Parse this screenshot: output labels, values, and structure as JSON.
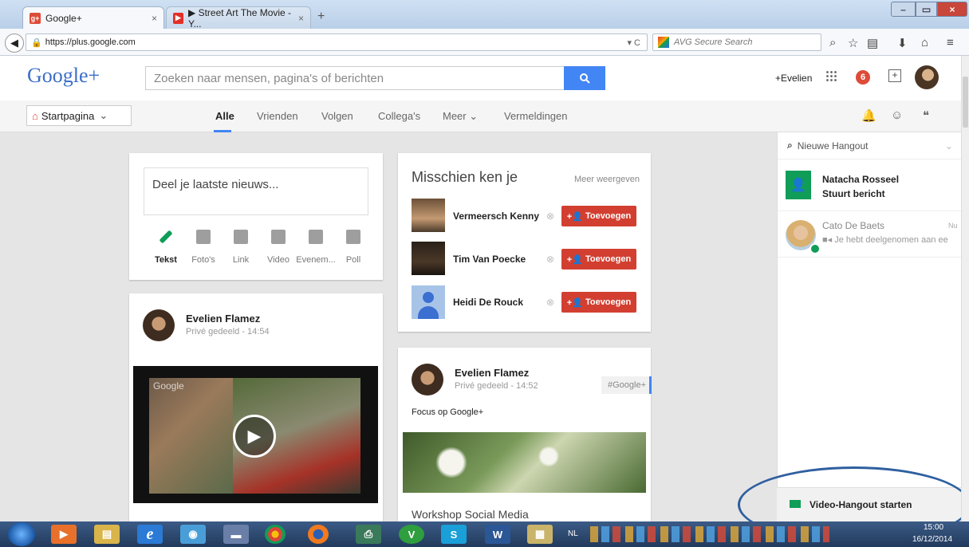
{
  "browser": {
    "tabs": [
      {
        "label": "Google+",
        "fav": "g+"
      },
      {
        "label": "▶ Street Art The Movie - Y...",
        "fav": "yt"
      }
    ],
    "new_tab": "+",
    "close_tab": "×",
    "url": "https://plus.google.com",
    "search_engine": "AVG Secure Search",
    "window_buttons": [
      "–",
      "▭",
      "×"
    ]
  },
  "gplus": {
    "logo": "Google+",
    "search_placeholder": "Zoeken naar mensen, pagina's of berichten",
    "profile_link": "+Evelien",
    "notification_count": "6",
    "home_menu": "Startpagina",
    "tabs": [
      "Alle",
      "Vrienden",
      "Volgen",
      "Collega's",
      "Meer",
      "Vermeldingen"
    ],
    "share_box": {
      "prompt": "Deel je laatste nieuws...",
      "actions": [
        "Tekst",
        "Foto's",
        "Link",
        "Video",
        "Evenem...",
        "Poll"
      ]
    },
    "suggestions": {
      "title": "Misschien ken je",
      "more": "Meer weergeven",
      "add_label": "Toevoegen",
      "people": [
        "Vermeersch Kenny",
        "Tim Van Poecke",
        "Heidi De Rouck"
      ]
    },
    "post1": {
      "author": "Evelien Flamez",
      "meta": "Privé gedeeld  -  14:54",
      "video_label": "Google"
    },
    "post2": {
      "author": "Evelien Flamez",
      "meta": "Privé gedeeld  -  14:52",
      "tag": "#Google+",
      "text": "Focus op Google+",
      "next_title": "Workshop Social Media"
    },
    "hangouts": {
      "new": "Nieuwe Hangout",
      "items": [
        {
          "name": "Natacha Rosseel",
          "status": "Stuurt bericht"
        },
        {
          "name": "Cato De Baets",
          "status": "Je hebt deelgenomen aan ee",
          "time": "Nu"
        }
      ],
      "video_start": "Video-Hangout starten"
    }
  },
  "taskbar": {
    "lang": "NL",
    "time": "15:00",
    "date": "16/12/2014"
  },
  "colors": {
    "accent": "#4285f4",
    "red": "#d23f31",
    "green": "#0f9d58"
  }
}
